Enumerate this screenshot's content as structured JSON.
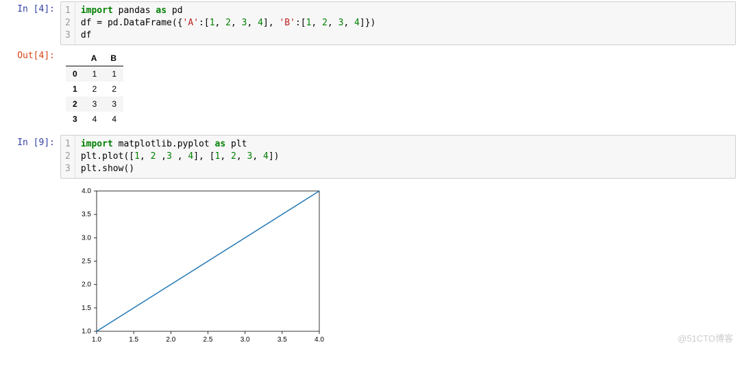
{
  "cells": {
    "c1": {
      "in_prompt": "In  [4]:",
      "gutter": [
        "1",
        "2",
        "3"
      ],
      "lines": [
        [
          {
            "t": "import",
            "c": "kw"
          },
          {
            "t": " pandas "
          },
          {
            "t": "as",
            "c": "kw"
          },
          {
            "t": " pd"
          }
        ],
        [
          {
            "t": "df = pd.DataFrame({"
          },
          {
            "t": "'A'",
            "c": "str"
          },
          {
            "t": ":["
          },
          {
            "t": "1",
            "c": "num"
          },
          {
            "t": ", "
          },
          {
            "t": "2",
            "c": "num"
          },
          {
            "t": ", "
          },
          {
            "t": "3",
            "c": "num"
          },
          {
            "t": ", "
          },
          {
            "t": "4",
            "c": "num"
          },
          {
            "t": "], "
          },
          {
            "t": "'B'",
            "c": "str"
          },
          {
            "t": ":["
          },
          {
            "t": "1",
            "c": "num"
          },
          {
            "t": ", "
          },
          {
            "t": "2",
            "c": "num"
          },
          {
            "t": ", "
          },
          {
            "t": "3",
            "c": "num"
          },
          {
            "t": ", "
          },
          {
            "t": "4",
            "c": "num"
          },
          {
            "t": "]})"
          }
        ],
        [
          {
            "t": "df"
          }
        ]
      ]
    },
    "c1_out": {
      "out_prompt": "Out[4]:",
      "df": {
        "columns": [
          "A",
          "B"
        ],
        "index": [
          "0",
          "1",
          "2",
          "3"
        ],
        "rows": [
          [
            "1",
            "1"
          ],
          [
            "2",
            "2"
          ],
          [
            "3",
            "3"
          ],
          [
            "4",
            "4"
          ]
        ]
      }
    },
    "c2": {
      "in_prompt": "In  [9]:",
      "gutter": [
        "1",
        "2",
        "3"
      ],
      "lines": [
        [
          {
            "t": "import",
            "c": "kw"
          },
          {
            "t": " matplotlib.pyplot "
          },
          {
            "t": "as",
            "c": "kw"
          },
          {
            "t": " plt"
          }
        ],
        [
          {
            "t": "plt.plot(["
          },
          {
            "t": "1",
            "c": "num"
          },
          {
            "t": ", "
          },
          {
            "t": "2",
            "c": "num"
          },
          {
            "t": " ,"
          },
          {
            "t": "3",
            "c": "num"
          },
          {
            "t": " , "
          },
          {
            "t": "4",
            "c": "num"
          },
          {
            "t": "], ["
          },
          {
            "t": "1",
            "c": "num"
          },
          {
            "t": ", "
          },
          {
            "t": "2",
            "c": "num"
          },
          {
            "t": ", "
          },
          {
            "t": "3",
            "c": "num"
          },
          {
            "t": ", "
          },
          {
            "t": "4",
            "c": "num"
          },
          {
            "t": "])"
          }
        ],
        [
          {
            "t": "plt.show()"
          }
        ]
      ]
    }
  },
  "chart_data": {
    "type": "line",
    "x": [
      1,
      2,
      3,
      4
    ],
    "y": [
      1,
      2,
      3,
      4
    ],
    "xticks": [
      1.0,
      1.5,
      2.0,
      2.5,
      3.0,
      3.5,
      4.0
    ],
    "yticks": [
      1.0,
      1.5,
      2.0,
      2.5,
      3.0,
      3.5,
      4.0
    ],
    "xlim": [
      1.0,
      4.0
    ],
    "ylim": [
      1.0,
      4.0
    ],
    "title": "",
    "xlabel": "",
    "ylabel": "",
    "line_color": "#1f77b4"
  },
  "watermark": "@51CTO博客"
}
